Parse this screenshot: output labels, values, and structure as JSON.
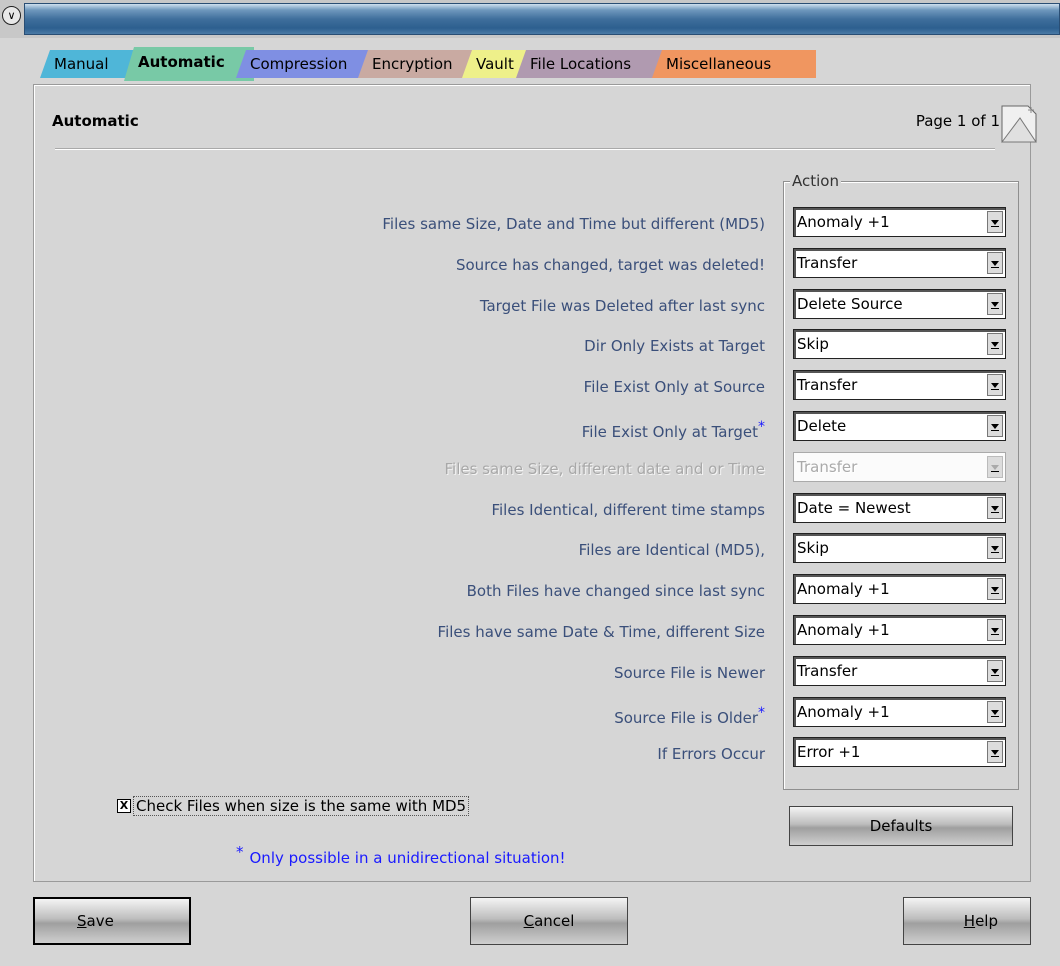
{
  "tabs": [
    {
      "label": "Manual",
      "color": "#4fb6d8"
    },
    {
      "label": "Automatic",
      "color": "#78c9a6",
      "active": true
    },
    {
      "label": "Compression",
      "color": "#7f8fe3"
    },
    {
      "label": "Encryption",
      "color": "#c9aaa2"
    },
    {
      "label": "Vault",
      "color": "#eef08a"
    },
    {
      "label": "File Locations",
      "color": "#b09ab0"
    },
    {
      "label": "Miscellaneous",
      "color": "#f09660"
    }
  ],
  "page": {
    "title": "Automatic",
    "count": "Page 1 of 1"
  },
  "group_title": "Action",
  "rows": [
    {
      "label": "Files same Size, Date and Time but different (MD5)",
      "value": "Anomaly +1"
    },
    {
      "label": "Source has changed, target was deleted!",
      "value": "Transfer"
    },
    {
      "label": "Target File was Deleted after last sync",
      "value": "Delete Source"
    },
    {
      "label": "Dir Only Exists at Target",
      "value": "Skip"
    },
    {
      "label": "File Exist Only at Source",
      "value": "Transfer"
    },
    {
      "label": "File Exist Only at Target",
      "value": "Delete",
      "star": "*"
    },
    {
      "label": "Files same Size, different date and or Time",
      "value": "Transfer",
      "disabled": true
    },
    {
      "label": "Files Identical, different time stamps",
      "value": "Date = Newest"
    },
    {
      "label": "Files are Identical (MD5),",
      "value": "Skip"
    },
    {
      "label": "Both Files have changed since last sync",
      "value": "Anomaly +1"
    },
    {
      "label": "Files have same Date & Time, different Size",
      "value": "Anomaly +1"
    },
    {
      "label": "Source File is Newer",
      "value": "Transfer"
    },
    {
      "label": "Source File is Older",
      "value": "Anomaly +1",
      "star": "*"
    },
    {
      "label": "If Errors Occur",
      "value": "Error +1"
    }
  ],
  "checkbox": {
    "label": "Check Files when size is the same with MD5",
    "checked": true,
    "mark": "X"
  },
  "note": {
    "star": "*",
    "text": "Only possible in a unidirectional situation!"
  },
  "buttons": {
    "defaults": "Defaults",
    "save_mnemonic": "S",
    "save_rest": "ave",
    "cancel_mnemonic": "C",
    "cancel_rest": "ancel",
    "help_mnemonic": "H",
    "help_rest": "elp"
  }
}
